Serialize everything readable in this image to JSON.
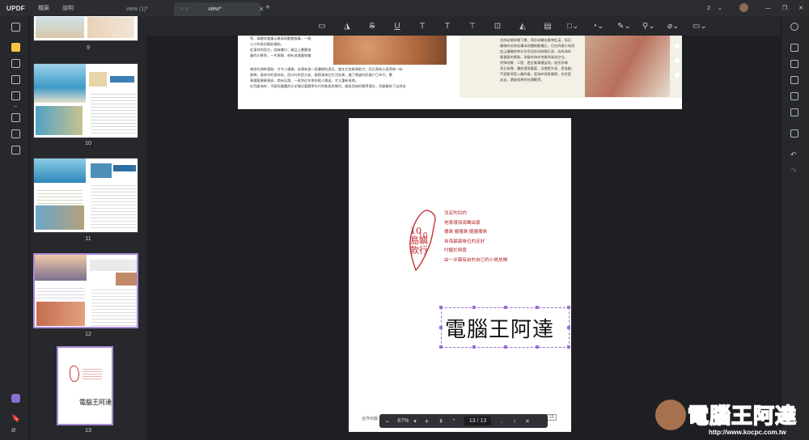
{
  "titlebar": {
    "logo": "UPDF",
    "menu": [
      "檔案",
      "說明"
    ],
    "tabs": [
      {
        "label": "view (1)*"
      },
      {
        "label": "view*"
      }
    ],
    "new_tab": "+",
    "page_count": "2",
    "window_controls": [
      "minimize-icon",
      "restore-icon",
      "close-icon"
    ]
  },
  "toolbar": {
    "tools": [
      "comment-icon",
      "highlight-icon",
      "strikethrough-icon",
      "underline-icon",
      "squiggly-icon",
      "text-icon",
      "textbox-icon",
      "callout-icon",
      "pencil-icon",
      "eraser-icon",
      "shape-icon",
      "sticker-icon",
      "pen-icon",
      "stamp-icon",
      "attachment-icon",
      "measure-icon"
    ]
  },
  "thumbnails": [
    {
      "label": "9"
    },
    {
      "label": "10"
    },
    {
      "label": "11"
    },
    {
      "label": "12"
    },
    {
      "label": "13"
    }
  ],
  "page_top": {
    "text_lines": [
      "等，樂聽與會議以最高與勤敬推薦，一個",
      "小小的島也精彩繽紛。",
      "從東林到西方，從緣雙口；據且上層層堆",
      "疊的沙景到，一片寧靜，唯有浪漫靈和聲",
      "魂悉的湖畔遺跡，才令人憧憬。追溯有過一段價線的過月，當年大批軍隊駐守，阿兵哥為小島帶來一絲",
      "熱鬧，東林村的東林街，西口村的西方街，都擠滿來往生活各異，讓了鼎盛的民國六〇年代，繁",
      "華隨著撤軍潮退，商街沒落，一直到近年來年輕人歸返，才又重新振興。",
      "在烈嶼海岸，平靜而廣闊的沙泥埔呈著戰爭年代的軌痕與陣列，戲島而寂的戰爭遺址，烈嶼最終了自然本"
    ],
    "right_text": [
      "花崗岩間同細下層，再形成獨自重來紅英，長石",
      "礦物的花崗岩構成地層無數種石，位在四處小地雨",
      "加上礦機與時光作用而形成剝蝕孔洞，成為海岸",
      "最重要的景點，承載的海岸地質與風化空谷。",
      "特殊地質：二厝、歷史集萬種盆地，地形多樣",
      "亮石祕寶，壩底環境豐富，這裡是外島、是島嶼，",
      "不過暫停是入願的東，是海岸保育團隊，也許是",
      "走走，還能找尋到另類戰爭。"
    ]
  },
  "page_main": {
    "stamp_text": "10島嶼款行",
    "lines": [
      "法定的目的",
      "地東環海海聲由景",
      "擺島 擺擺島 擺擺擺島",
      "自海最最後位的足好",
      "吋握於與度",
      "由一步報有前的自已的小島放開"
    ],
    "signature": "電腦王阿達",
    "footer_left": "合作出版",
    "footer_right": "13"
  },
  "zoombar": {
    "zoom_out": "−",
    "zoom_value": "87%",
    "zoom_in": "+",
    "page_indicator": "13 / 13",
    "close": "✕"
  },
  "watermark": {
    "title": "電腦王阿達",
    "url": "http://www.kocpc.com.tw"
  }
}
